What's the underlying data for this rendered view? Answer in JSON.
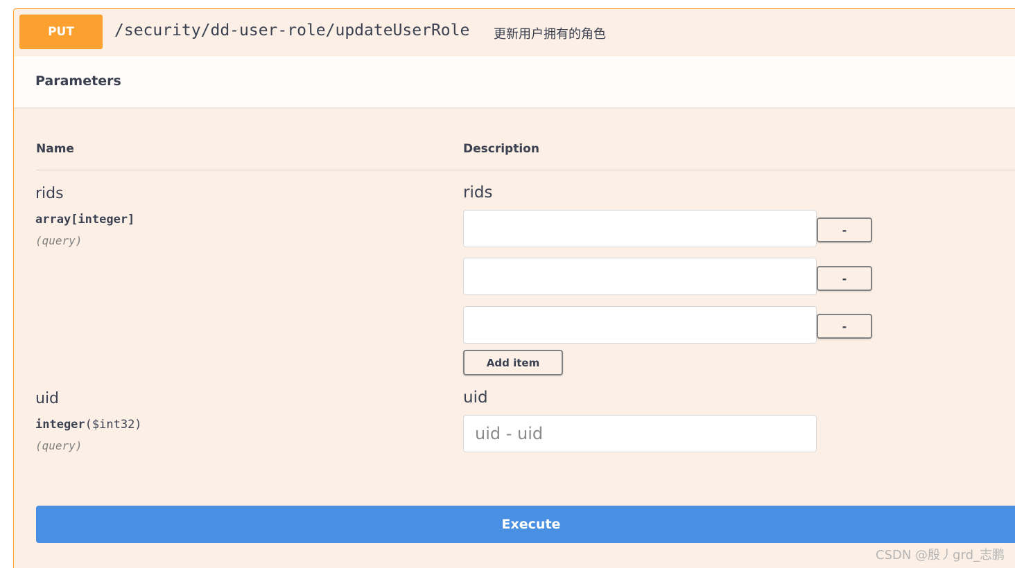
{
  "operation": {
    "method": "PUT",
    "path": "/security/dd-user-role/updateUserRole",
    "summary": "更新用户拥有的角色"
  },
  "parameters_section": {
    "title": "Parameters",
    "col_name": "Name",
    "col_description": "Description"
  },
  "params": {
    "rids": {
      "name": "rids",
      "type": "array[integer]",
      "in": "(query)",
      "label": "rids",
      "items": [
        {
          "value": "",
          "remove_label": "-"
        },
        {
          "value": "",
          "remove_label": "-"
        },
        {
          "value": "",
          "remove_label": "-"
        }
      ],
      "add_item_label": "Add item"
    },
    "uid": {
      "name": "uid",
      "type": "integer",
      "format": "($int32)",
      "in": "(query)",
      "label": "uid",
      "placeholder": "uid - uid",
      "value": ""
    }
  },
  "execute_label": "Execute",
  "watermark": "CSDN @殷丿grd_志鹏",
  "colors": {
    "put_accent": "#fca130",
    "block_background": "#fcf0e6",
    "execute_blue": "#4990e2",
    "text": "#3b4151"
  }
}
